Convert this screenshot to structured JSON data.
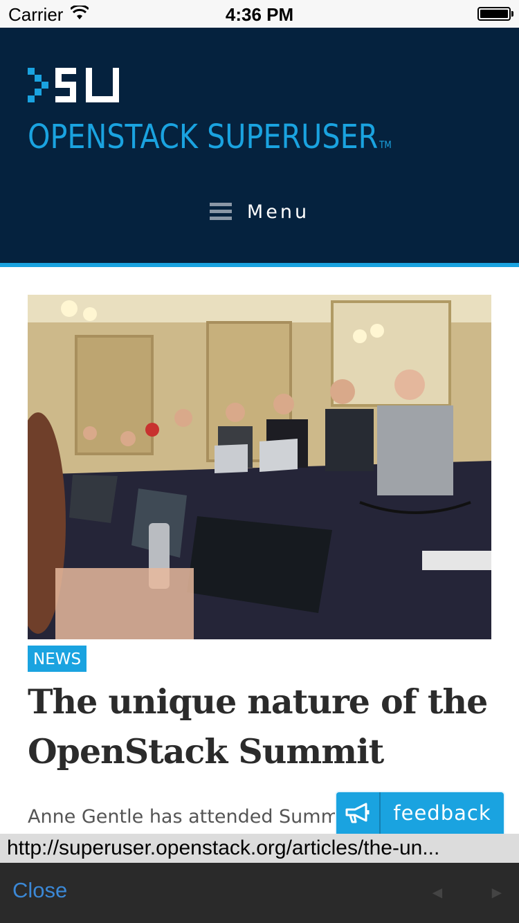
{
  "status_bar": {
    "carrier": "Carrier",
    "time": "4:36 PM"
  },
  "site": {
    "name": "OPENSTACK SUPERUSER",
    "trademark": "TM",
    "logo_icon": "su-logo-icon",
    "menu_label": "Menu",
    "menu_icon": "hamburger-icon",
    "brand_color": "#1aa3e0",
    "header_bg": "#05223e"
  },
  "article": {
    "category": "NEWS",
    "title": "The unique nature of the OpenStack Summit",
    "excerpt": "Anne Gentle has attended Summits",
    "hero_icon": "photo-of-laptop-meeting-room"
  },
  "feedback": {
    "label": "feedback",
    "icon": "megaphone-icon"
  },
  "browser": {
    "url": "http://superuser.openstack.org/articles/the-un...",
    "close_label": "Close",
    "back_glyph": "◄",
    "forward_glyph": "►"
  }
}
